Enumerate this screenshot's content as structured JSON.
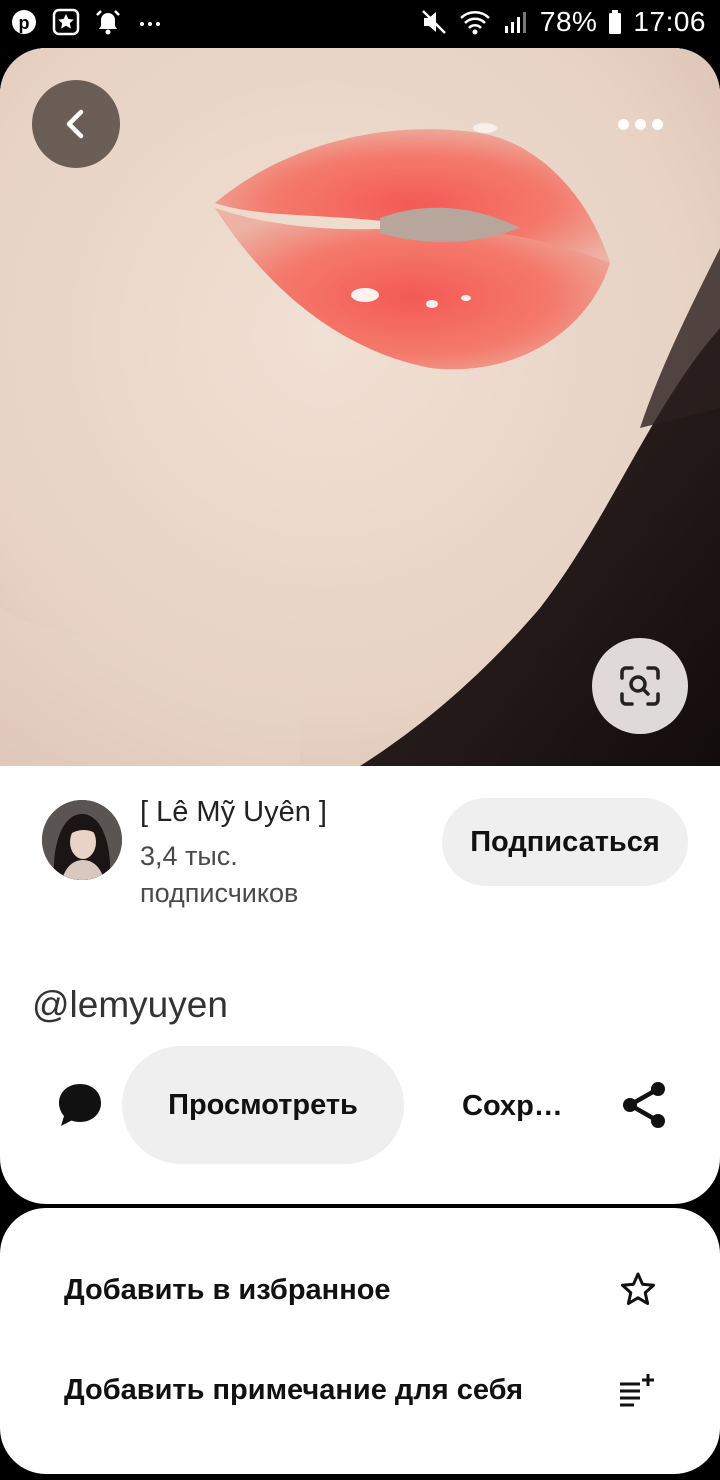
{
  "status_bar": {
    "battery": "78%",
    "time": "17:06",
    "icons": [
      "pinterest-icon",
      "star-app-icon",
      "alarm-icon",
      "more-notifications-icon",
      "mute-icon",
      "wifi-icon",
      "signal-icon",
      "battery-icon"
    ]
  },
  "pin": {
    "image_icons": [
      "back-arrow-icon",
      "more-options-icon",
      "visual-search-icon"
    ]
  },
  "creator": {
    "name": "[ Lê Mỹ Uyên ]",
    "followers_line1": "3,4 тыс.",
    "followers_line2": "подписчиков",
    "follow_label": "Подписаться"
  },
  "username": "@lemyuyen",
  "actions": {
    "view_label": "Просмотреть",
    "save_label": "Сохр…"
  },
  "sheet": {
    "items": [
      {
        "label": "Добавить в избранное",
        "icon": "star-outline-icon"
      },
      {
        "label": "Добавить примечание для себя",
        "icon": "add-note-icon"
      }
    ]
  },
  "colors": {
    "background": "#000000",
    "card": "#ffffff",
    "pill": "#efefef",
    "text": "#111111"
  }
}
